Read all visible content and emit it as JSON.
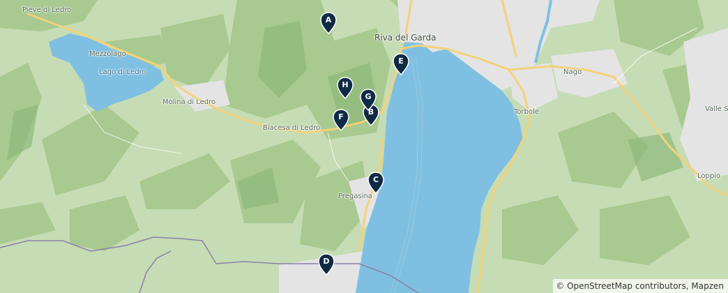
{
  "map": {
    "colors": {
      "land": "#c6dcb4",
      "forest": "#a6c88e",
      "water": "#7fc0e2",
      "road": "#f3d27a",
      "urban": "#e3e3e3",
      "border": "#8a7fa8",
      "marker": "#0f2a45"
    },
    "places": [
      {
        "id": "pieve-di-ledro",
        "label": "Pieve di Ledro"
      },
      {
        "id": "mezzolago",
        "label": "Mezzolago"
      },
      {
        "id": "lago-di-ledro",
        "label": "Lago di Ledro"
      },
      {
        "id": "molina-di-ledro",
        "label": "Molina di Ledro"
      },
      {
        "id": "biacesa-di-ledro",
        "label": "Biacesa di Ledro"
      },
      {
        "id": "riva-del-garda",
        "label": "Riva del Garda"
      },
      {
        "id": "nago",
        "label": "Nago"
      },
      {
        "id": "torbole",
        "label": "Torbole"
      },
      {
        "id": "valle-s",
        "label": "Valle S"
      },
      {
        "id": "loppio",
        "label": "Loppio"
      },
      {
        "id": "pregasina",
        "label": "Pregasina"
      }
    ],
    "markers": [
      {
        "id": "A",
        "label": "A"
      },
      {
        "id": "B",
        "label": "B"
      },
      {
        "id": "C",
        "label": "C"
      },
      {
        "id": "D",
        "label": "D"
      },
      {
        "id": "E",
        "label": "E"
      },
      {
        "id": "F",
        "label": "F"
      },
      {
        "id": "G",
        "label": "G"
      },
      {
        "id": "H",
        "label": "H"
      }
    ],
    "attribution": {
      "symbol": "©",
      "osm": "OpenStreetMap contributors",
      "separator": ", ",
      "provider": "Mapzen"
    }
  }
}
